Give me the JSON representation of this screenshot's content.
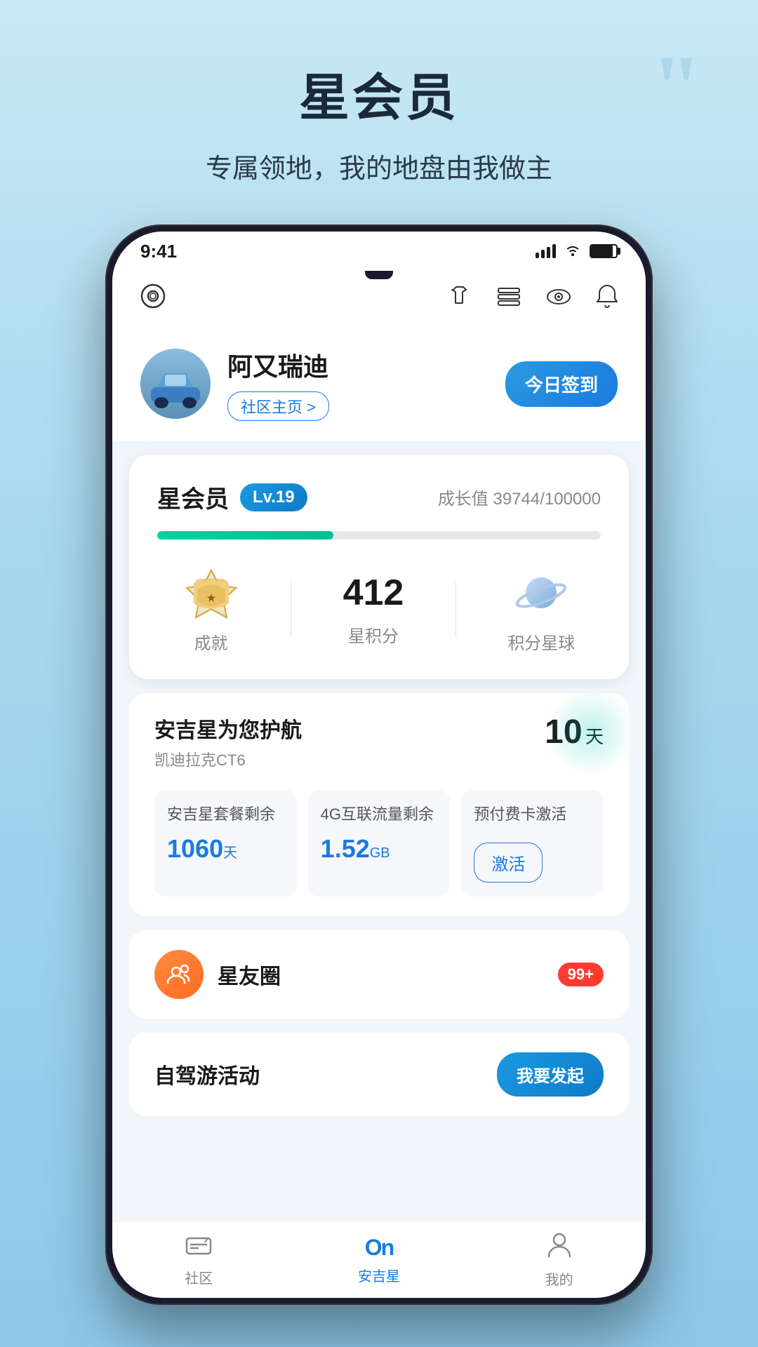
{
  "page": {
    "title": "星会员",
    "subtitle": "专属领地，我的地盘由我做主"
  },
  "status_bar": {
    "time": "9:41"
  },
  "nav_icons": {
    "settings": "⊙",
    "shirt": "👕",
    "layers": "☰",
    "eye": "👁",
    "bell": "🔔"
  },
  "profile": {
    "name": "阿又瑞迪",
    "community_link": "社区主页 >",
    "check_in": "今日签到"
  },
  "member": {
    "title": "星会员",
    "level": "Lv.19",
    "growth_label": "成长值",
    "growth_current": "39744",
    "growth_total": "100000",
    "progress_percent": 39.744,
    "achievement_label": "成就",
    "points": "412",
    "points_label": "星积分",
    "planet_label": "积分星球"
  },
  "service": {
    "title": "安吉星为您护航",
    "car_model": "凯迪拉克CT6",
    "days_remaining": "10",
    "days_unit": "天",
    "package_label": "安吉星套餐剩余",
    "package_value": "1060",
    "package_unit": "天",
    "traffic_label": "4G互联流量剩余",
    "traffic_value": "1.52",
    "traffic_unit": "GB",
    "prepaid_label": "预付费卡激活",
    "activate_btn": "激活"
  },
  "social": {
    "title": "星友圈",
    "badge": "99+"
  },
  "activity": {
    "title": "自驾游活动",
    "launch_btn": "我要发起"
  },
  "bottom_nav": {
    "community_label": "社区",
    "anjixing_label": "安吉星",
    "mine_label": "我的",
    "anjixing_logo": "On"
  }
}
